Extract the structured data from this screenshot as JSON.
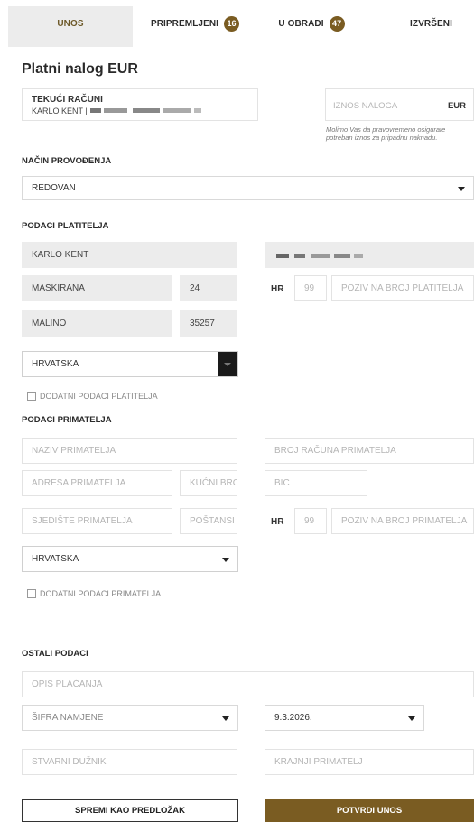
{
  "tabs": [
    {
      "label": "UNOS"
    },
    {
      "label": "PRIPREMLJENI",
      "count": "16"
    },
    {
      "label": "U OBRADI",
      "count": "47"
    },
    {
      "label": "IZVRŠENI"
    }
  ],
  "page_title": "Platni nalog EUR",
  "account": {
    "type": "TEKUĆI RAČUNI",
    "owner": "KARLO KENT |"
  },
  "amount": {
    "placeholder": "IZNOS NALOGA",
    "currency": "EUR",
    "note": "Molimo Vas da pravovremeno osigurate potreban iznos za pripadnu naknadu."
  },
  "execution": {
    "title": "NAČIN PROVOĐENJA",
    "value": "REDOVAN"
  },
  "payer": {
    "title": "PODACI PLATITELJA",
    "name": "KARLO KENT",
    "street": "MASKIRANA",
    "house_no": "24",
    "city": "MALINO",
    "postcode": "35257",
    "country": "HRVATSKA",
    "hr": "HR",
    "model": "99",
    "reference_placeholder": "POZIV NA BROJ PLATITELJA",
    "extra_label": "DODATNI PODACI PLATITELJA"
  },
  "recipient": {
    "title": "PODACI PRIMATELJA",
    "name_placeholder": "NAZIV PRIMATELJA",
    "account_placeholder": "BROJ RAČUNA PRIMATELJA",
    "address_placeholder": "ADRESA PRIMATELJA",
    "house_placeholder": "KUĆNI BRC",
    "bic_placeholder": "BIC",
    "city_placeholder": "SJEDIŠTE PRIMATELJA",
    "postcode_placeholder": "POŠTANSI",
    "hr": "HR",
    "model": "99",
    "reference_placeholder": "POZIV NA BROJ PRIMATELJA",
    "country": "HRVATSKA",
    "extra_label": "DODATNI PODACI PRIMATELJA"
  },
  "other": {
    "title": "OSTALI PODACI",
    "description_placeholder": "OPIS PLAĆANJA",
    "purpose_code": "ŠIFRA NAMJENE",
    "date": "9.3.2026.",
    "actual_debtor_placeholder": "STVARNI DUŽNIK",
    "final_recipient_placeholder": "KRAJNJI PRIMATELJ"
  },
  "buttons": {
    "save_template": "SPREMI KAO PREDLOŽAK",
    "confirm": "POTVRDI UNOS"
  },
  "colors": {
    "accent": "#7a5c22",
    "filled_bg": "#ececec"
  }
}
